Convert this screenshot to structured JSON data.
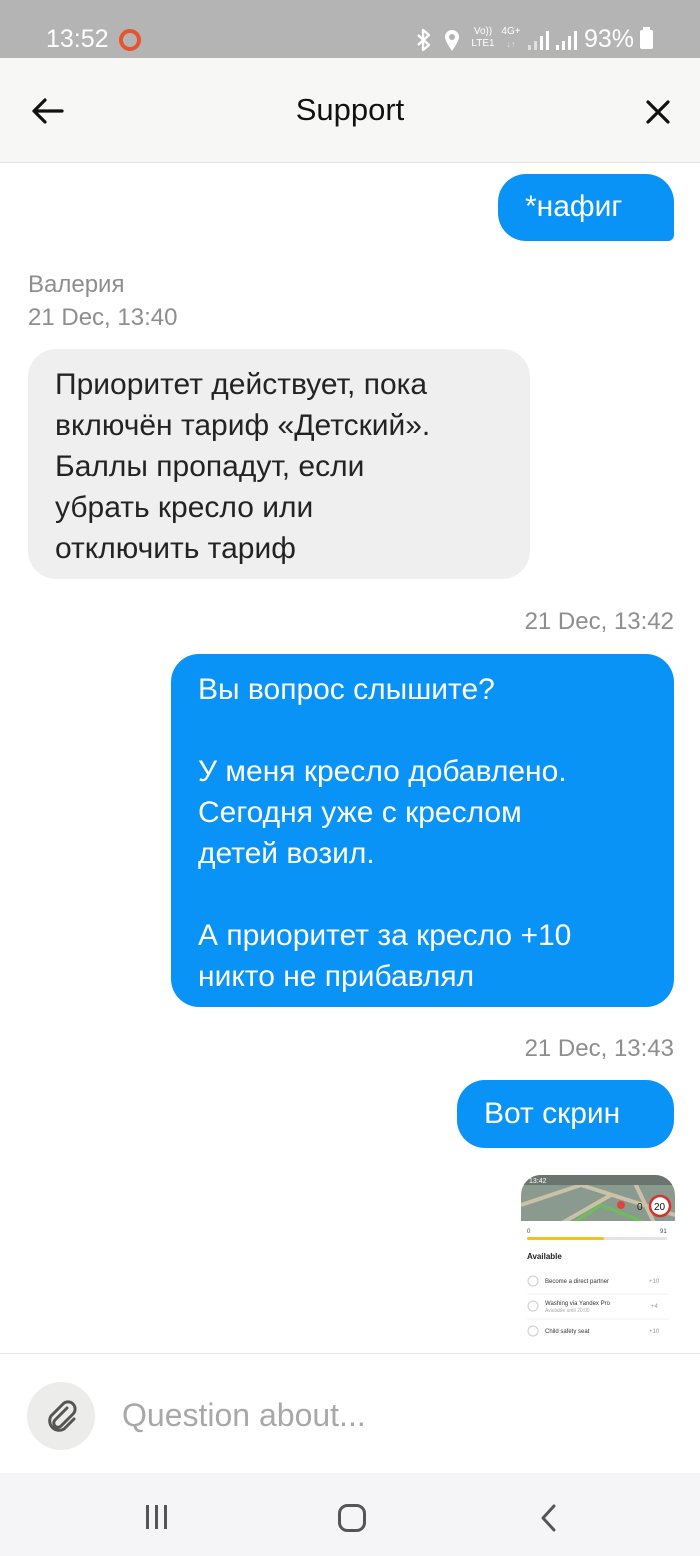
{
  "status_bar": {
    "time": "13:52",
    "recording_indicator": "recording-dot",
    "icons": [
      "bluetooth-icon",
      "location-icon",
      "volte-icon",
      "4g-icon",
      "signal-icon",
      "signal-icon"
    ],
    "network_top": "Vo))",
    "network_bottom": "LTE1",
    "network_type": "4G+",
    "battery": "93%"
  },
  "header": {
    "title": "Support",
    "back_icon": "arrow-left-icon",
    "close_icon": "close-icon"
  },
  "messages": [
    {
      "direction": "out",
      "text": "*нафиг"
    },
    {
      "direction": "in",
      "sender": "Валерия",
      "timestamp": "21 Dec, 13:40",
      "text": "Приоритет действует, пока\nвключён тариф «Детский».\nБаллы пропадут, если\nубрать кресло или\nотключить тариф"
    },
    {
      "direction": "out",
      "timestamp": "21 Dec, 13:42",
      "text": "Вы вопрос слышите?\n\nУ меня кресло добавлено.\nСегодня уже с креслом\nдетей возил.\n\nА приоритет за кресло +10\nникто не прибавлял"
    },
    {
      "direction": "out",
      "timestamp": "21 Dec, 13:43",
      "text": "Вот скрин"
    },
    {
      "direction": "out",
      "type": "image",
      "image": {
        "time": "13:42",
        "badge_left": "0",
        "badge_right": "20",
        "progress_start": "0",
        "progress_end": "91",
        "progress_fraction": 0.55,
        "section": "Available",
        "items": [
          {
            "label": "Become a direct partner",
            "points": "+10"
          },
          {
            "label": "Washing via Yandex Pro",
            "sub": "Available until 20:00",
            "points": "+4"
          },
          {
            "label": "Child safety seat",
            "points": "+10"
          }
        ]
      }
    }
  ],
  "input": {
    "placeholder": "Question about...",
    "value": "",
    "attach_icon": "paperclip-icon"
  },
  "nav_bar": {
    "recents_icon": "recents-icon",
    "home_icon": "home-icon",
    "back_icon": "back-chevron-icon"
  },
  "colors": {
    "outgoing_bubble": "#0a93f6",
    "incoming_bubble": "#efefef",
    "status_bar": "#b4b4b4",
    "header_bg": "#f7f7f5"
  }
}
